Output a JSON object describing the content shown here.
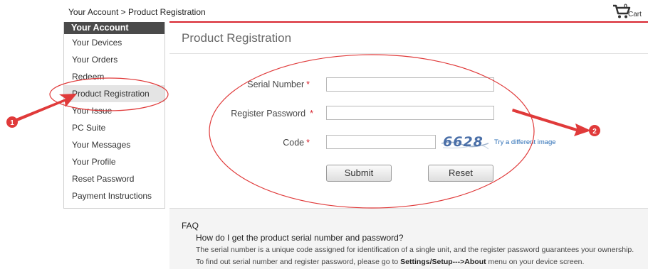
{
  "breadcrumb": {
    "root": "Your Account",
    "separator": " > ",
    "current": "Product Registration"
  },
  "cart": {
    "count": "0",
    "label": "Cart",
    "icon": "cart-icon"
  },
  "sidebar": {
    "header": "Your Account",
    "items": [
      {
        "label": "Your Devices"
      },
      {
        "label": "Your Orders"
      },
      {
        "label": "Redeem"
      },
      {
        "label": "Product Registration",
        "active": true
      },
      {
        "label": "Your Issue"
      },
      {
        "label": "PC Suite"
      },
      {
        "label": "Your Messages"
      },
      {
        "label": "Your Profile"
      },
      {
        "label": "Reset Password"
      },
      {
        "label": "Payment Instructions"
      }
    ]
  },
  "page": {
    "title": "Product Registration"
  },
  "form": {
    "serial_label": "Serial Number",
    "serial_value": "",
    "password_label": "Register Password",
    "password_value": "",
    "code_label": "Code",
    "code_value": "",
    "required_mark": "*",
    "captcha_text": "6628",
    "try_link": "Try a different image",
    "submit_label": "Submit",
    "reset_label": "Reset"
  },
  "faq": {
    "title": "FAQ",
    "question": "How do I get the product serial number and password?",
    "answer1": "The serial number is a unique code assigned for identification of a single unit, and the register password guarantees your ownership.",
    "answer2_prefix": "To find out serial number and register password, please go to ",
    "answer2_bold": "Settings/Setup--->About",
    "answer2_suffix": " menu on your device screen."
  },
  "annotations": {
    "marker1": "1",
    "marker2": "2",
    "color": "#e03a3a"
  },
  "colors": {
    "accent_red": "#d8252f",
    "sidebar_header": "#4a4a4a",
    "link": "#2a6db5"
  }
}
